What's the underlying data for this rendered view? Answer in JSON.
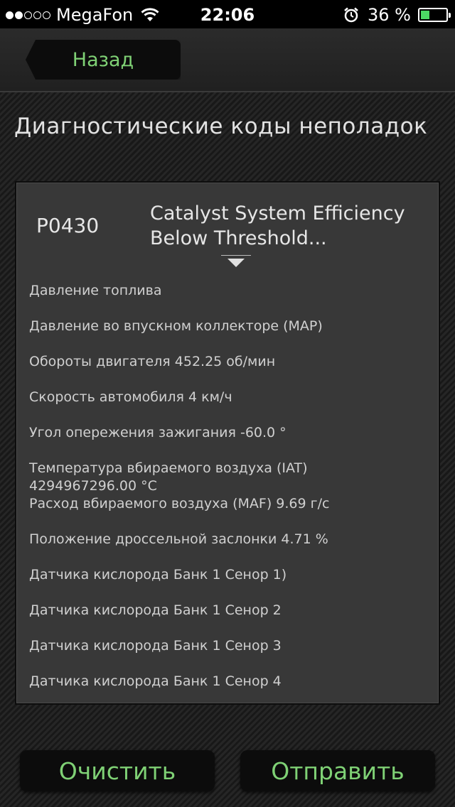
{
  "status_bar": {
    "carrier": "MegaFon",
    "signal_bars_filled": 2,
    "signal_bars_total": 5,
    "time": "22:06",
    "battery_percent": "36 %",
    "battery_level": 0.36,
    "battery_color": "#4cd964",
    "icons": [
      "wifi-icon",
      "alarm-icon",
      "battery-icon"
    ]
  },
  "nav": {
    "back_label": "Назад"
  },
  "page": {
    "title": "Диагностические коды неполадок"
  },
  "dtc": {
    "code": "P0430",
    "description": "Catalyst System Efficiency Below Threshold...",
    "parameters": [
      "Давление топлива",
      "Давление во впускном коллекторе (MAP)",
      "Обороты двигателя 452.25 об/мин",
      "Скорость автомобиля 4 км/ч",
      "Угол опережения зажигания -60.0 °",
      "Температура вбираемого воздуха (IAT)\n4294967296.00 °C",
      "Расход вбираемого воздуха (MAF) 9.69 г/с",
      "Положение дроссельной заслонки 4.71 %",
      "Датчика кислорода Банк 1 Сенор 1)",
      "Датчика кислорода Банк 1 Сенор 2",
      "Датчика кислорода Банк 1 Сенор 3",
      "Датчика кислорода Банк 1 Сенор 4"
    ]
  },
  "actions": {
    "clear_label": "Очистить",
    "send_label": "Отправить"
  },
  "colors": {
    "accent_green": "#7fd175",
    "background": "#1e1e1e",
    "panel": "#383838"
  }
}
